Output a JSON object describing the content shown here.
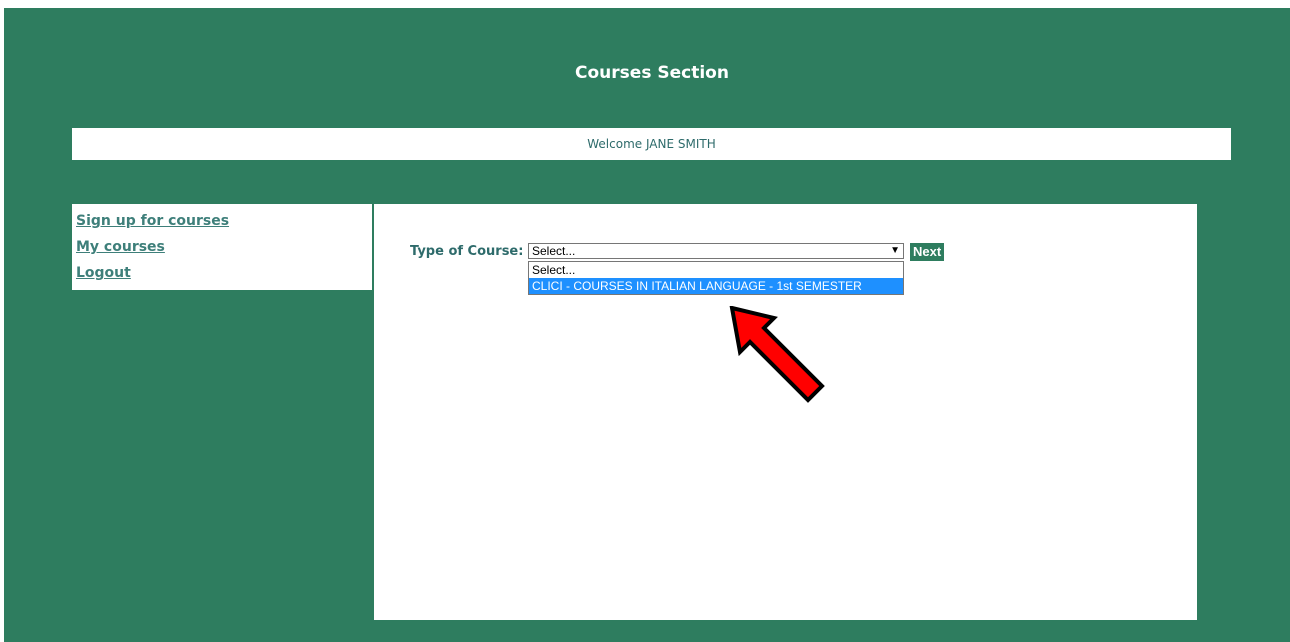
{
  "header": {
    "title": "Courses Section"
  },
  "welcome": {
    "text": "Welcome JANE SMITH"
  },
  "sidebar": {
    "items": [
      {
        "label": "Sign up for courses"
      },
      {
        "label": "My courses"
      },
      {
        "label": "Logout"
      }
    ]
  },
  "form": {
    "type_label": "Type of Course:",
    "select_value": "Select...",
    "options": [
      {
        "label": "Select...",
        "highlighted": false
      },
      {
        "label": "CLICI - COURSES IN ITALIAN LANGUAGE - 1st SEMESTER",
        "highlighted": true
      }
    ],
    "next_label": "Next"
  },
  "colors": {
    "page_background": "#2e7d5f",
    "link": "#3e7f7a",
    "highlight": "#1e90ff",
    "annotation_arrow": "#ff0000"
  },
  "annotation": {
    "icon": "red-arrow-icon",
    "points_to": "dropdown option 2"
  }
}
